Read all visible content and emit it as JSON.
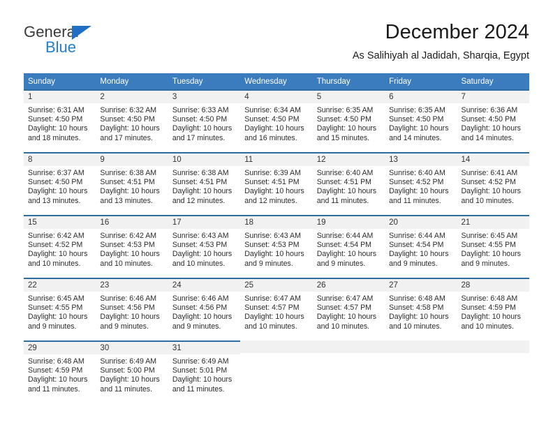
{
  "logo": {
    "text_top": "General",
    "text_bottom": "Blue",
    "accent_color": "#1f7fd4",
    "triangle_color": "#1f6fc4"
  },
  "header": {
    "title": "December 2024",
    "subtitle": "As Salihiyah al Jadidah, Sharqia, Egypt"
  },
  "theme": {
    "header_row_bg": "#3b7cbf",
    "cell_top_border": "#2e6da4",
    "daynum_band_bg": "#f1f1f1"
  },
  "weekdays": [
    "Sunday",
    "Monday",
    "Tuesday",
    "Wednesday",
    "Thursday",
    "Friday",
    "Saturday"
  ],
  "weeks": [
    [
      {
        "day": "1",
        "sunrise": "Sunrise: 6:31 AM",
        "sunset": "Sunset: 4:50 PM",
        "daylight_1": "Daylight: 10 hours",
        "daylight_2": "and 18 minutes."
      },
      {
        "day": "2",
        "sunrise": "Sunrise: 6:32 AM",
        "sunset": "Sunset: 4:50 PM",
        "daylight_1": "Daylight: 10 hours",
        "daylight_2": "and 17 minutes."
      },
      {
        "day": "3",
        "sunrise": "Sunrise: 6:33 AM",
        "sunset": "Sunset: 4:50 PM",
        "daylight_1": "Daylight: 10 hours",
        "daylight_2": "and 17 minutes."
      },
      {
        "day": "4",
        "sunrise": "Sunrise: 6:34 AM",
        "sunset": "Sunset: 4:50 PM",
        "daylight_1": "Daylight: 10 hours",
        "daylight_2": "and 16 minutes."
      },
      {
        "day": "5",
        "sunrise": "Sunrise: 6:35 AM",
        "sunset": "Sunset: 4:50 PM",
        "daylight_1": "Daylight: 10 hours",
        "daylight_2": "and 15 minutes."
      },
      {
        "day": "6",
        "sunrise": "Sunrise: 6:35 AM",
        "sunset": "Sunset: 4:50 PM",
        "daylight_1": "Daylight: 10 hours",
        "daylight_2": "and 14 minutes."
      },
      {
        "day": "7",
        "sunrise": "Sunrise: 6:36 AM",
        "sunset": "Sunset: 4:50 PM",
        "daylight_1": "Daylight: 10 hours",
        "daylight_2": "and 14 minutes."
      }
    ],
    [
      {
        "day": "8",
        "sunrise": "Sunrise: 6:37 AM",
        "sunset": "Sunset: 4:50 PM",
        "daylight_1": "Daylight: 10 hours",
        "daylight_2": "and 13 minutes."
      },
      {
        "day": "9",
        "sunrise": "Sunrise: 6:38 AM",
        "sunset": "Sunset: 4:51 PM",
        "daylight_1": "Daylight: 10 hours",
        "daylight_2": "and 13 minutes."
      },
      {
        "day": "10",
        "sunrise": "Sunrise: 6:38 AM",
        "sunset": "Sunset: 4:51 PM",
        "daylight_1": "Daylight: 10 hours",
        "daylight_2": "and 12 minutes."
      },
      {
        "day": "11",
        "sunrise": "Sunrise: 6:39 AM",
        "sunset": "Sunset: 4:51 PM",
        "daylight_1": "Daylight: 10 hours",
        "daylight_2": "and 12 minutes."
      },
      {
        "day": "12",
        "sunrise": "Sunrise: 6:40 AM",
        "sunset": "Sunset: 4:51 PM",
        "daylight_1": "Daylight: 10 hours",
        "daylight_2": "and 11 minutes."
      },
      {
        "day": "13",
        "sunrise": "Sunrise: 6:40 AM",
        "sunset": "Sunset: 4:52 PM",
        "daylight_1": "Daylight: 10 hours",
        "daylight_2": "and 11 minutes."
      },
      {
        "day": "14",
        "sunrise": "Sunrise: 6:41 AM",
        "sunset": "Sunset: 4:52 PM",
        "daylight_1": "Daylight: 10 hours",
        "daylight_2": "and 10 minutes."
      }
    ],
    [
      {
        "day": "15",
        "sunrise": "Sunrise: 6:42 AM",
        "sunset": "Sunset: 4:52 PM",
        "daylight_1": "Daylight: 10 hours",
        "daylight_2": "and 10 minutes."
      },
      {
        "day": "16",
        "sunrise": "Sunrise: 6:42 AM",
        "sunset": "Sunset: 4:53 PM",
        "daylight_1": "Daylight: 10 hours",
        "daylight_2": "and 10 minutes."
      },
      {
        "day": "17",
        "sunrise": "Sunrise: 6:43 AM",
        "sunset": "Sunset: 4:53 PM",
        "daylight_1": "Daylight: 10 hours",
        "daylight_2": "and 10 minutes."
      },
      {
        "day": "18",
        "sunrise": "Sunrise: 6:43 AM",
        "sunset": "Sunset: 4:53 PM",
        "daylight_1": "Daylight: 10 hours",
        "daylight_2": "and 9 minutes."
      },
      {
        "day": "19",
        "sunrise": "Sunrise: 6:44 AM",
        "sunset": "Sunset: 4:54 PM",
        "daylight_1": "Daylight: 10 hours",
        "daylight_2": "and 9 minutes."
      },
      {
        "day": "20",
        "sunrise": "Sunrise: 6:44 AM",
        "sunset": "Sunset: 4:54 PM",
        "daylight_1": "Daylight: 10 hours",
        "daylight_2": "and 9 minutes."
      },
      {
        "day": "21",
        "sunrise": "Sunrise: 6:45 AM",
        "sunset": "Sunset: 4:55 PM",
        "daylight_1": "Daylight: 10 hours",
        "daylight_2": "and 9 minutes."
      }
    ],
    [
      {
        "day": "22",
        "sunrise": "Sunrise: 6:45 AM",
        "sunset": "Sunset: 4:55 PM",
        "daylight_1": "Daylight: 10 hours",
        "daylight_2": "and 9 minutes."
      },
      {
        "day": "23",
        "sunrise": "Sunrise: 6:46 AM",
        "sunset": "Sunset: 4:56 PM",
        "daylight_1": "Daylight: 10 hours",
        "daylight_2": "and 9 minutes."
      },
      {
        "day": "24",
        "sunrise": "Sunrise: 6:46 AM",
        "sunset": "Sunset: 4:56 PM",
        "daylight_1": "Daylight: 10 hours",
        "daylight_2": "and 9 minutes."
      },
      {
        "day": "25",
        "sunrise": "Sunrise: 6:47 AM",
        "sunset": "Sunset: 4:57 PM",
        "daylight_1": "Daylight: 10 hours",
        "daylight_2": "and 10 minutes."
      },
      {
        "day": "26",
        "sunrise": "Sunrise: 6:47 AM",
        "sunset": "Sunset: 4:57 PM",
        "daylight_1": "Daylight: 10 hours",
        "daylight_2": "and 10 minutes."
      },
      {
        "day": "27",
        "sunrise": "Sunrise: 6:48 AM",
        "sunset": "Sunset: 4:58 PM",
        "daylight_1": "Daylight: 10 hours",
        "daylight_2": "and 10 minutes."
      },
      {
        "day": "28",
        "sunrise": "Sunrise: 6:48 AM",
        "sunset": "Sunset: 4:59 PM",
        "daylight_1": "Daylight: 10 hours",
        "daylight_2": "and 10 minutes."
      }
    ],
    [
      {
        "day": "29",
        "sunrise": "Sunrise: 6:48 AM",
        "sunset": "Sunset: 4:59 PM",
        "daylight_1": "Daylight: 10 hours",
        "daylight_2": "and 11 minutes."
      },
      {
        "day": "30",
        "sunrise": "Sunrise: 6:49 AM",
        "sunset": "Sunset: 5:00 PM",
        "daylight_1": "Daylight: 10 hours",
        "daylight_2": "and 11 minutes."
      },
      {
        "day": "31",
        "sunrise": "Sunrise: 6:49 AM",
        "sunset": "Sunset: 5:01 PM",
        "daylight_1": "Daylight: 10 hours",
        "daylight_2": "and 11 minutes."
      },
      {
        "day": "",
        "sunrise": "",
        "sunset": "",
        "daylight_1": "",
        "daylight_2": ""
      },
      {
        "day": "",
        "sunrise": "",
        "sunset": "",
        "daylight_1": "",
        "daylight_2": ""
      },
      {
        "day": "",
        "sunrise": "",
        "sunset": "",
        "daylight_1": "",
        "daylight_2": ""
      },
      {
        "day": "",
        "sunrise": "",
        "sunset": "",
        "daylight_1": "",
        "daylight_2": ""
      }
    ]
  ]
}
